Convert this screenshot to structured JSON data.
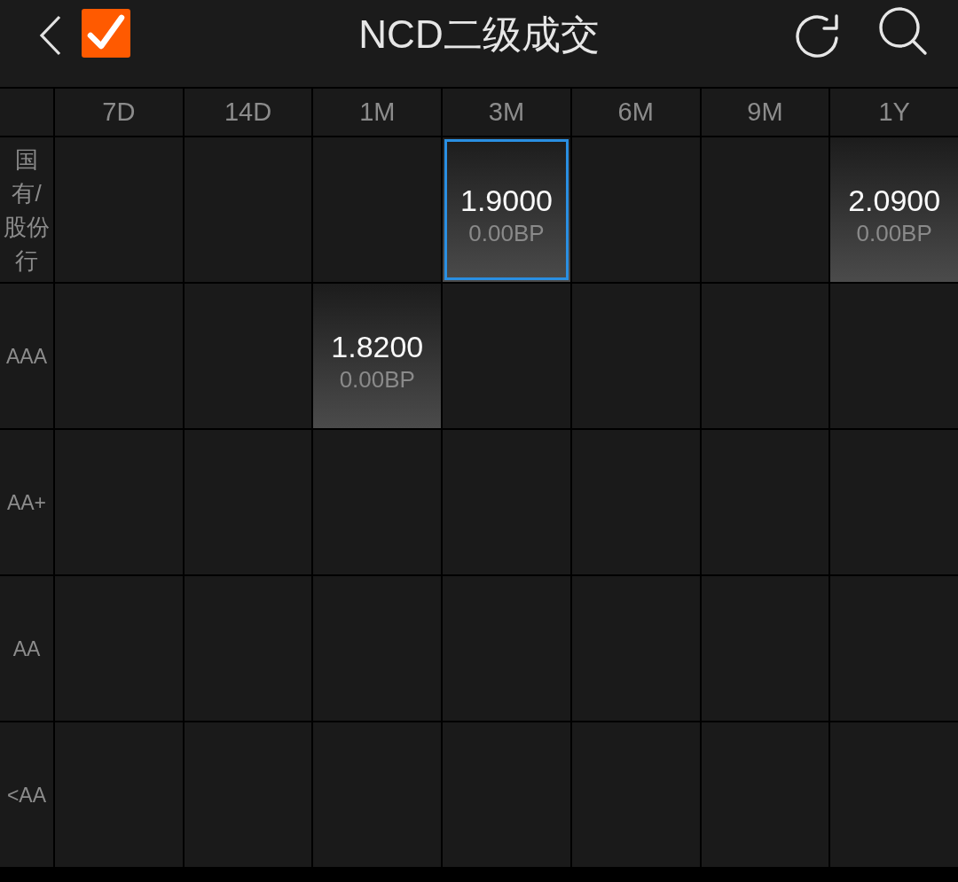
{
  "header": {
    "title": "NCD二级成交",
    "checked": true
  },
  "grid": {
    "columns": [
      "7D",
      "14D",
      "1M",
      "3M",
      "6M",
      "9M",
      "1Y"
    ],
    "rows": [
      {
        "label": "国有/股份行",
        "cells": [
          {
            "selected": false
          },
          {
            "selected": false
          },
          {
            "selected": false
          },
          {
            "yield": "1.9000",
            "change": "0.00BP",
            "selected": true
          },
          {
            "selected": false
          },
          {
            "selected": false
          },
          {
            "yield": "2.0900",
            "change": "0.00BP",
            "selected": false
          }
        ]
      },
      {
        "label": "AAA",
        "cells": [
          {
            "selected": false
          },
          {
            "selected": false
          },
          {
            "yield": "1.8200",
            "change": "0.00BP",
            "selected": false
          },
          {
            "selected": false
          },
          {
            "selected": false
          },
          {
            "selected": false
          },
          {
            "selected": false
          }
        ]
      },
      {
        "label": "AA+",
        "cells": [
          {
            "selected": false
          },
          {
            "selected": false
          },
          {
            "selected": false
          },
          {
            "selected": false
          },
          {
            "selected": false
          },
          {
            "selected": false
          },
          {
            "selected": false
          }
        ]
      },
      {
        "label": "AA",
        "cells": [
          {
            "selected": false
          },
          {
            "selected": false
          },
          {
            "selected": false
          },
          {
            "selected": false
          },
          {
            "selected": false
          },
          {
            "selected": false
          },
          {
            "selected": false
          }
        ]
      },
      {
        "label": "<AA",
        "cells": [
          {
            "selected": false
          },
          {
            "selected": false
          },
          {
            "selected": false
          },
          {
            "selected": false
          },
          {
            "selected": false
          },
          {
            "selected": false
          },
          {
            "selected": false
          }
        ]
      }
    ]
  }
}
